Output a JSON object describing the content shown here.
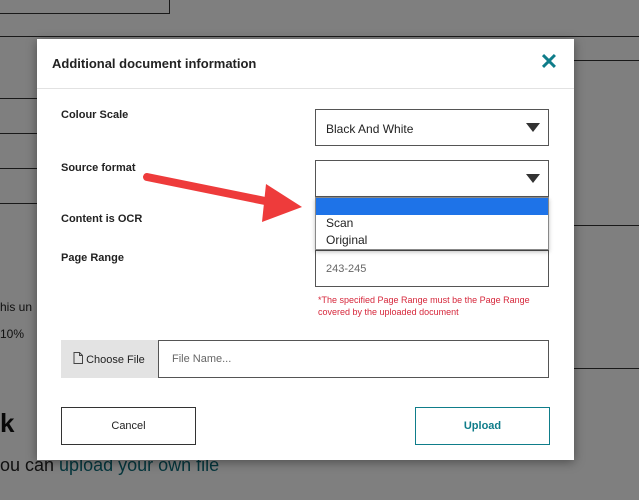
{
  "background": {
    "snippet_1": "his un",
    "snippet_2": "10%",
    "heading_fragment": "k",
    "upload_text": "ou can ",
    "upload_link": "upload your own file"
  },
  "modal": {
    "title": "Additional document information",
    "close_icon": "close-icon",
    "fields": {
      "colour_scale_label": "Colour Scale",
      "colour_scale_value": "Black And White",
      "source_format_label": "Source format",
      "source_format_value": "",
      "source_format_options": [
        "",
        "Scan",
        "Original"
      ],
      "ocr_label": "Content is OCR",
      "page_range_label": "Page Range",
      "page_range_value": "243-245"
    },
    "page_range_warning": "*The specified Page Range must be the Page Range covered by the uploaded document",
    "file": {
      "choose_label": "Choose File",
      "file_icon": "file-icon",
      "placeholder": "File Name..."
    },
    "buttons": {
      "cancel": "Cancel",
      "upload": "Upload"
    }
  },
  "colors": {
    "accent": "#0f7d8a",
    "warning": "#d6273b",
    "selection": "#1e73e8",
    "annotation_arrow": "#ee3b3b"
  }
}
